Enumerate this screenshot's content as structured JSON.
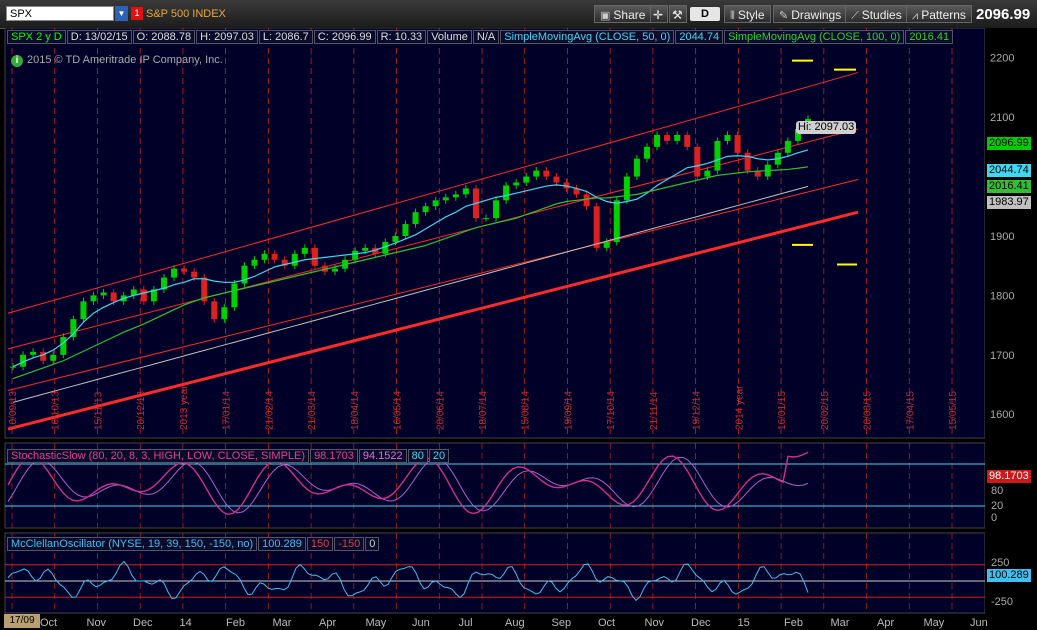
{
  "toolbar": {
    "symbol": "SPX",
    "badge": "1",
    "symbol_name": "S&P 500 INDEX",
    "share_label": "Share",
    "d_label": "D",
    "style_label": "Style",
    "drawings_label": "Drawings",
    "studies_label": "Studies",
    "patterns_label": "Patterns",
    "last_price": "2096.99"
  },
  "stats": {
    "timeframe": "SPX 2 y D",
    "date": "D: 13/02/15",
    "open": "O: 2088.78",
    "high": "H: 2097.03",
    "low": "L: 2086.7",
    "close": "C: 2096.99",
    "range": "R: 10.33",
    "volume_label": "Volume",
    "volume_value": "N/A",
    "sma50_label": "SimpleMovingAvg (CLOSE, 50, 0)",
    "sma50_value": "2044.74",
    "sma100_label": "SimpleMovingAvg (CLOSE, 100, 0)",
    "sma100_value": "2016.41"
  },
  "copyright": "2015 © TD Ameritrade IP Company, Inc.",
  "colors": {
    "background": "#000028",
    "grid": "#cc2020",
    "price_tag": "#00cc00",
    "sma50": "#40d8f0",
    "sma100": "#30c030",
    "sma200": "#c0c0c0",
    "channel": "#ff2a2a",
    "stoch": "#d0308c",
    "mcclellan": "#40c0f0"
  },
  "price_axis": {
    "ticks": [
      "2200",
      "2100",
      "1900",
      "1800",
      "1700",
      "1600"
    ],
    "tags": {
      "last": "2096.99",
      "sma50": "2044.74",
      "sma100": "2016.41",
      "sma200": "1983.97"
    },
    "hi_label": "Hi: 2097.03"
  },
  "date_labels": [
    "10/09/13",
    "16/10/13",
    "15/11/13",
    "20/12/13",
    "2013 year",
    "17/01/14",
    "21/02/14",
    "21/03/14",
    "18/04/14",
    "16/05/14",
    "20/06/14",
    "18/07/14",
    "15/08/14",
    "19/09/14",
    "17/10/14",
    "21/11/14",
    "19/12/14",
    "2014 year",
    "16/01/15",
    "20/02/15",
    "20/03/15",
    "17/04/15",
    "15/05/15"
  ],
  "month_labels": [
    "Oct",
    "Nov",
    "Dec",
    "14",
    "Feb",
    "Mar",
    "Apr",
    "May",
    "Jun",
    "Jul",
    "Aug",
    "Sep",
    "Oct",
    "Nov",
    "Dec",
    "15",
    "Feb",
    "Mar",
    "Apr",
    "May",
    "Jun"
  ],
  "stochastic": {
    "label": "StochasticSlow (80, 20, 8, 3, HIGH, LOW, CLOSE, SIMPLE)",
    "k_value": "98.1703",
    "d_value": "94.1522",
    "level_high": "80",
    "level_low": "20",
    "tag": "98.1703",
    "axis": [
      "80",
      "20",
      "0"
    ]
  },
  "mcclellan": {
    "label": "McClellanOscillator (NYSE, 19, 39, 150, -150, no)",
    "value": "100.289",
    "upper": "150",
    "lower": "-150",
    "zero": "0",
    "tag": "100.289",
    "axis": [
      "250",
      "0",
      "-250"
    ]
  },
  "corner_label": "17/09",
  "chart_data": {
    "type": "line",
    "title": "SPX 2 y D",
    "ylabel": "",
    "ylim": [
      1560,
      2250
    ],
    "series": [
      {
        "name": "SPX",
        "values": [
          1680,
          1700,
          1705,
          1690,
          1700,
          1730,
          1760,
          1790,
          1800,
          1805,
          1790,
          1800,
          1810,
          1790,
          1810,
          1830,
          1845,
          1840,
          1830,
          1790,
          1760,
          1780,
          1820,
          1850,
          1860,
          1870,
          1860,
          1850,
          1870,
          1880,
          1850,
          1840,
          1845,
          1860,
          1875,
          1880,
          1870,
          1890,
          1900,
          1920,
          1940,
          1950,
          1960,
          1965,
          1970,
          1980,
          1930,
          1930,
          1960,
          1985,
          1990,
          2000,
          2010,
          2000,
          1990,
          1980,
          1970,
          1950,
          1880,
          1890,
          1960,
          2000,
          2030,
          2050,
          2070,
          2060,
          2070,
          2050,
          2000,
          2010,
          2060,
          2070,
          2040,
          2010,
          2000,
          2020,
          2040,
          2060,
          2080,
          2097
        ]
      },
      {
        "name": "SimpleMovingAvg (CLOSE, 50, 0)",
        "values": [
          1680,
          1688,
          1695,
          1700,
          1708,
          1720,
          1735,
          1755,
          1770,
          1780,
          1788,
          1795,
          1800,
          1804,
          1808,
          1812,
          1818,
          1822,
          1828,
          1828,
          1824,
          1822,
          1822,
          1826,
          1832,
          1840,
          1848,
          1852,
          1856,
          1860,
          1862,
          1864,
          1866,
          1868,
          1870,
          1872,
          1876,
          1882,
          1888,
          1895,
          1902,
          1912,
          1922,
          1932,
          1940,
          1950,
          1955,
          1960,
          1965,
          1968,
          1972,
          1976,
          1980,
          1984,
          1986,
          1984,
          1980,
          1975,
          1965,
          1958,
          1955,
          1958,
          1962,
          1972,
          1985,
          1995,
          2005,
          2015,
          2018,
          2022,
          2028,
          2034,
          2035,
          2034,
          2030,
          2028,
          2030,
          2034,
          2040,
          2044.74
        ]
      },
      {
        "name": "SimpleMovingAvg (CLOSE, 100, 0)",
        "values": [
          1660,
          1666,
          1672,
          1678,
          1684,
          1690,
          1698,
          1706,
          1714,
          1722,
          1730,
          1738,
          1745,
          1752,
          1760,
          1768,
          1776,
          1784,
          1790,
          1796,
          1800,
          1804,
          1808,
          1812,
          1816,
          1820,
          1824,
          1828,
          1832,
          1836,
          1840,
          1844,
          1848,
          1852,
          1856,
          1860,
          1864,
          1868,
          1872,
          1876,
          1880,
          1884,
          1890,
          1896,
          1902,
          1908,
          1914,
          1918,
          1922,
          1926,
          1930,
          1936,
          1942,
          1948,
          1954,
          1958,
          1960,
          1962,
          1964,
          1964,
          1966,
          1968,
          1970,
          1974,
          1978,
          1982,
          1986,
          1990,
          1994,
          1998,
          2002,
          2004,
          2006,
          2008,
          2009,
          2010,
          2011,
          2012,
          2014,
          2016.41
        ]
      }
    ]
  }
}
